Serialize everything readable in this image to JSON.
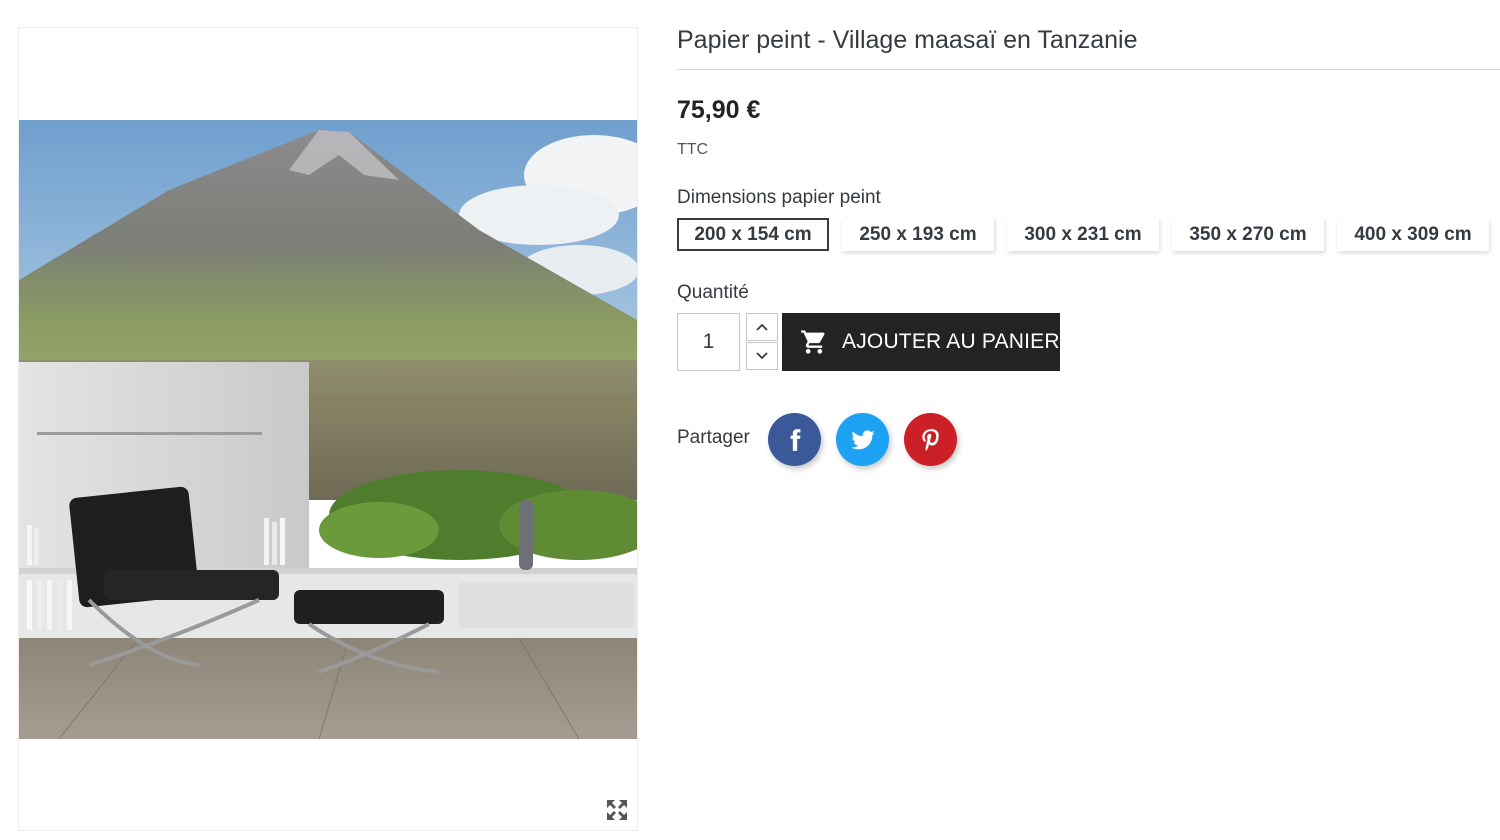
{
  "product": {
    "title": "Papier peint - Village maasaï en Tanzanie",
    "price": "75,90 €",
    "tax_label": "TTC",
    "image_alt": "Papier peint - Village maasaï en Tanzanie"
  },
  "dimensions": {
    "label": "Dimensions papier peint",
    "options": [
      "200 x 154 cm",
      "250 x 193 cm",
      "300 x 231 cm",
      "350 x 270 cm",
      "400 x 309 cm"
    ],
    "selected": "200 x 154 cm"
  },
  "quantity": {
    "label": "Quantité",
    "value": "1"
  },
  "cart": {
    "button_label": "AJOUTER AU PANIER",
    "icon": "shopping-cart-icon"
  },
  "share": {
    "label": "Partager",
    "networks": [
      {
        "name": "facebook",
        "icon": "facebook-icon",
        "color": "#3b5998"
      },
      {
        "name": "twitter",
        "icon": "twitter-icon",
        "color": "#1da1f2"
      },
      {
        "name": "pinterest",
        "icon": "pinterest-icon",
        "color": "#cb2027"
      }
    ]
  },
  "colors": {
    "cart_button": "#232323",
    "text": "#363a41"
  }
}
